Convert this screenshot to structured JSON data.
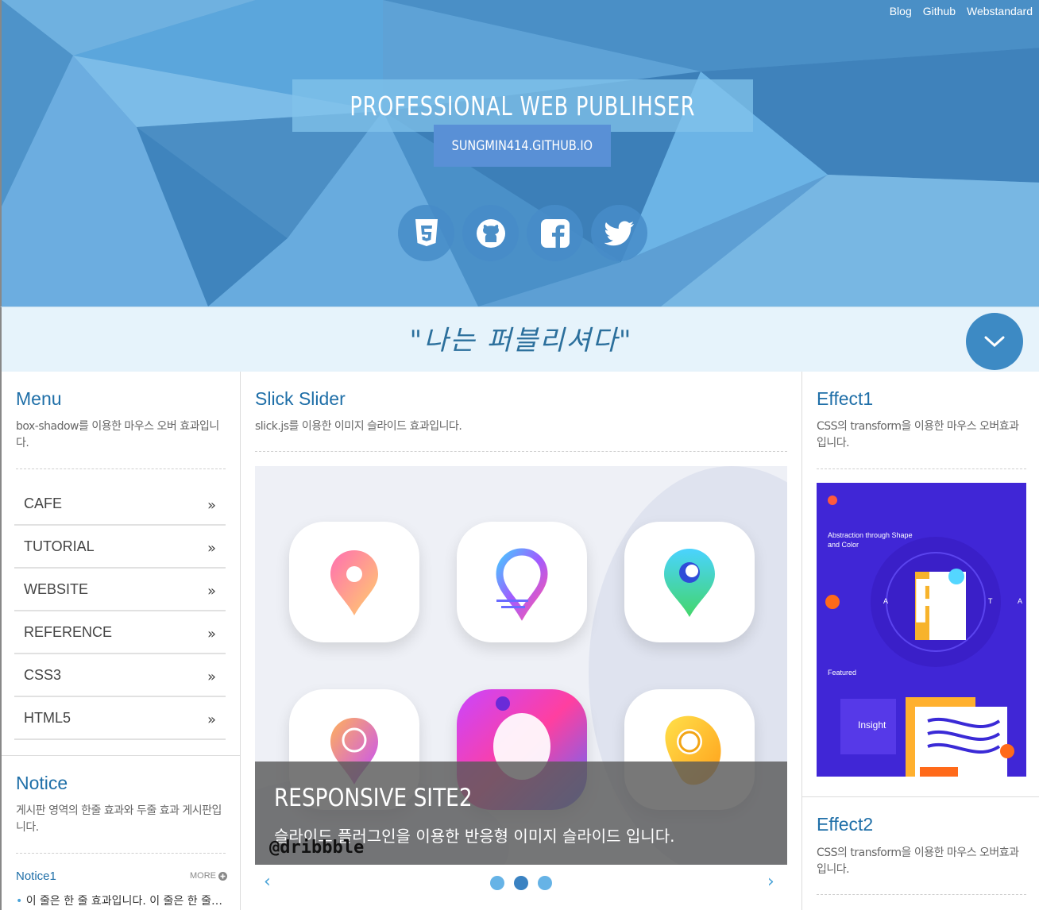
{
  "top_nav": [
    "Blog",
    "Github",
    "Webstandard"
  ],
  "hero": {
    "title": "PROFESSIONAL WEB PUBLIHSER",
    "subtitle": "SUNGMIN414.GITHUB.IO",
    "social_icons": [
      "html5-icon",
      "github-icon",
      "facebook-icon",
      "twitter-icon"
    ]
  },
  "slogan": "\"나는 퍼블리셔다\"",
  "menu": {
    "title": "Menu",
    "desc": "box-shadow를 이용한 마우스 오버 효과입니다.",
    "items": [
      "CAFE",
      "TUTORIAL",
      "WEBSITE",
      "REFERENCE",
      "CSS3",
      "HTML5"
    ],
    "chevron": "»"
  },
  "notice": {
    "title": "Notice",
    "desc": "게시판 영역의 한줄 효과와 두줄 효과 게시판입니다.",
    "tab": "Notice1",
    "more": "MORE",
    "line": "이 줄은 한 줄 효과입니다. 이 줄은 한 줄…"
  },
  "slider": {
    "title": "Slick Slider",
    "desc": "slick.js를 이용한 이미지 슬라이드 효과입니다.",
    "caption_title": "RESPONSIVE SITE2",
    "caption_desc": "슬라이드 플러그인을 이용한 반응형 이미지 슬라이드 입니다.",
    "watermark": "@dribbble",
    "prev": "‹",
    "next": "›"
  },
  "effect1": {
    "title": "Effect1",
    "desc": "CSS의 transform을 이용한 마우스 오버효과입니다.",
    "card_heading": "Abstraction through Shape and Color",
    "card_featured": "Featured",
    "card_insight": "Insight",
    "card_letter": "R",
    "card_a1": "A",
    "card_t": "T",
    "card_a2": "A"
  },
  "effect2": {
    "title": "Effect2",
    "desc": "CSS의 transform을 이용한 마우스 오버효과입니다."
  },
  "colors": {
    "header_bg": "#4f95c8",
    "accent": "#1f6fa8",
    "slogan_bg": "#e6f3fb"
  }
}
